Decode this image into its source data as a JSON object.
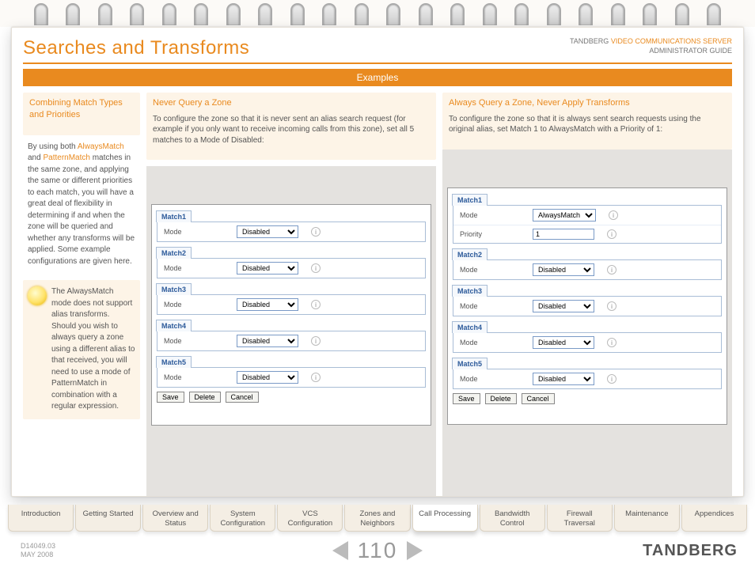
{
  "header": {
    "title": "Searches and Transforms",
    "corp_line1_a": "TANDBERG ",
    "corp_line1_b": "VIDEO COMMUNICATIONS SERVER",
    "corp_line2": "ADMINISTRATOR GUIDE"
  },
  "banner": "Examples",
  "left": {
    "heading": "Combining Match Types and Priorities",
    "para_a": "By using both ",
    "para_b": "AlwaysMatch",
    "para_c": " and ",
    "para_d": "PatternMatch",
    "para_e": " matches in the same zone, and applying the same or different priorities to each match, you will have a great deal of flexibility in determining if and when the zone will be queried and whether any transforms will be applied.  Some example configurations are given here.",
    "note_a": "The ",
    "note_b": "AlwaysMatch",
    "note_c": " mode does not support alias transforms.  Should you wish to always query a zone using a different alias to that received, you will need to use a mode of ",
    "note_d": "PatternMatch",
    "note_e": " in combination with a regular expression."
  },
  "mid": {
    "heading": "Never Query a Zone",
    "para_a": "To configure the zone so that it is never sent an alias search request (for example if you only want to receive incoming calls from this zone), set all 5 matches to a ",
    "para_b": "Mode",
    "para_c": " of ",
    "para_d": "Disabled",
    "para_e": ":",
    "matches": [
      "Match1",
      "Match2",
      "Match3",
      "Match4",
      "Match5"
    ],
    "mode_label": "Mode",
    "mode_value": "Disabled"
  },
  "right": {
    "heading": "Always Query a Zone, Never Apply Transforms",
    "para_a": "To configure the zone so that it is always sent search requests using the original alias, set ",
    "para_b": "Match 1",
    "para_c": " to ",
    "para_d": "AlwaysMatch",
    "para_e": " with a ",
    "para_f": "Priority",
    "para_g": " of ",
    "para_h": "1",
    "para_i": ":",
    "match1": "Match1",
    "matches_rest": [
      "Match2",
      "Match3",
      "Match4",
      "Match5"
    ],
    "mode_label": "Mode",
    "mode_always": "AlwaysMatch",
    "mode_disabled": "Disabled",
    "priority_label": "Priority",
    "priority_value": "1"
  },
  "buttons": {
    "save": "Save",
    "delete": "Delete",
    "cancel": "Cancel"
  },
  "info_glyph": "i",
  "tabs": [
    "Introduction",
    "Getting Started",
    "Overview and Status",
    "System Configuration",
    "VCS Configuration",
    "Zones and Neighbors",
    "Call Processing",
    "Bandwidth Control",
    "Firewall Traversal",
    "Maintenance",
    "Appendices"
  ],
  "tabs_active_index": 6,
  "footer": {
    "doc": "D14049.03",
    "date": "MAY 2008",
    "page": "110",
    "brand": "TANDBERG"
  },
  "chart_data": {
    "type": "table",
    "title": "Zone match configuration examples",
    "panels": [
      {
        "name": "Never Query a Zone",
        "rows": [
          {
            "match": "Match1",
            "Mode": "Disabled"
          },
          {
            "match": "Match2",
            "Mode": "Disabled"
          },
          {
            "match": "Match3",
            "Mode": "Disabled"
          },
          {
            "match": "Match4",
            "Mode": "Disabled"
          },
          {
            "match": "Match5",
            "Mode": "Disabled"
          }
        ]
      },
      {
        "name": "Always Query a Zone, Never Apply Transforms",
        "rows": [
          {
            "match": "Match1",
            "Mode": "AlwaysMatch",
            "Priority": 1
          },
          {
            "match": "Match2",
            "Mode": "Disabled"
          },
          {
            "match": "Match3",
            "Mode": "Disabled"
          },
          {
            "match": "Match4",
            "Mode": "Disabled"
          },
          {
            "match": "Match5",
            "Mode": "Disabled"
          }
        ]
      }
    ]
  }
}
